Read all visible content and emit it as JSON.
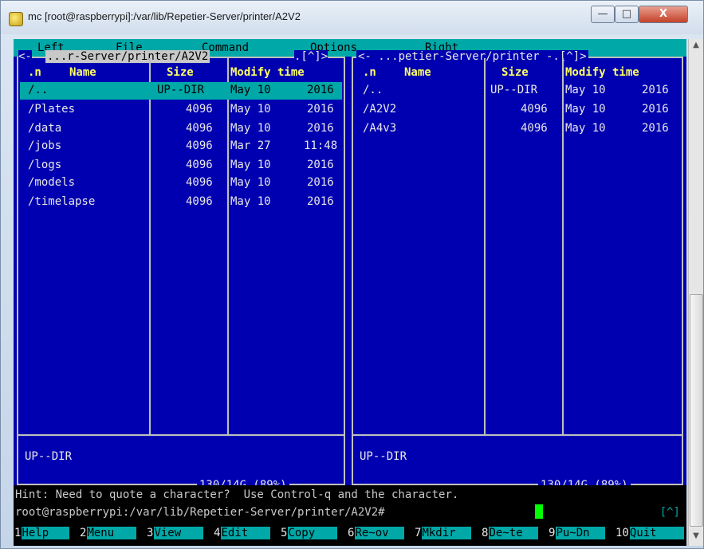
{
  "window": {
    "title": "mc [root@raspberrypi]:/var/lib/Repetier-Server/printer/A2V2",
    "minimize": "—",
    "maximize": "□",
    "close": "X"
  },
  "menubar": {
    "items": [
      "Left",
      "File",
      "Command",
      "Options",
      "Right"
    ]
  },
  "left_panel": {
    "path": "...r-Server/printer/A2V2",
    "hist": ".[^]>",
    "corner": "<-",
    "columns": {
      "name_mark": ".n",
      "name": "Name",
      "size": "Size",
      "modify": "Modify time"
    },
    "rows": [
      {
        "name": "/..",
        "size": "UP--DIR",
        "date": "May 10",
        "time": "2016"
      },
      {
        "name": "/Plates",
        "size": "4096",
        "date": "May 10",
        "time": "2016"
      },
      {
        "name": "/data",
        "size": "4096",
        "date": "May 10",
        "time": "2016"
      },
      {
        "name": "/jobs",
        "size": "4096",
        "date": "Mar 27",
        "time": "11:48"
      },
      {
        "name": "/logs",
        "size": "4096",
        "date": "May 10",
        "time": "2016"
      },
      {
        "name": "/models",
        "size": "4096",
        "date": "May 10",
        "time": "2016"
      },
      {
        "name": "/timelapse",
        "size": "4096",
        "date": "May 10",
        "time": "2016"
      }
    ],
    "mini_status": "UP--DIR",
    "usage": "130/14G (89%)"
  },
  "right_panel": {
    "path": "<- ...petier-Server/printer -.[^]>",
    "columns": {
      "name_mark": ".n",
      "name": "Name",
      "size": "Size",
      "modify": "Modify time"
    },
    "rows": [
      {
        "name": "/..",
        "size": "UP--DIR",
        "date": "May 10",
        "time": "2016"
      },
      {
        "name": "/A2V2",
        "size": "4096",
        "date": "May 10",
        "time": "2016"
      },
      {
        "name": "/A4v3",
        "size": "4096",
        "date": "May 10",
        "time": "2016"
      }
    ],
    "mini_status": "UP--DIR",
    "usage": "130/14G (89%)"
  },
  "hint": "Hint: Need to quote a character?  Use Control-q and the character.",
  "prompt": "root@raspberrypi:/var/lib/Repetier-Server/printer/A2V2#",
  "prompt_flag": "[^]",
  "fkeys": [
    {
      "num": "1",
      "label": "Help"
    },
    {
      "num": "2",
      "label": "Menu"
    },
    {
      "num": "3",
      "label": "View"
    },
    {
      "num": "4",
      "label": "Edit"
    },
    {
      "num": "5",
      "label": "Copy"
    },
    {
      "num": "6",
      "label": "Re~ov"
    },
    {
      "num": "7",
      "label": "Mkdir"
    },
    {
      "num": "8",
      "label": "De~te"
    },
    {
      "num": "9",
      "label": "Pu~Dn"
    },
    {
      "num": "10",
      "label": "Quit"
    }
  ]
}
